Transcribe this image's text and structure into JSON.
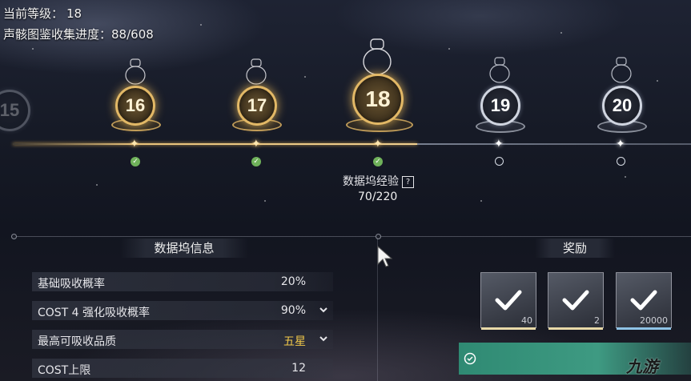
{
  "hud": {
    "level_label": "当前等级：",
    "level_value": "18",
    "collection_label": "声骸图鉴收集进度：",
    "collection_value": "88/608"
  },
  "partial_level": "15",
  "levels": [
    {
      "value": "16",
      "state": "reached",
      "claimed": true
    },
    {
      "value": "17",
      "state": "reached",
      "claimed": true
    },
    {
      "value": "18",
      "state": "current",
      "claimed": true
    },
    {
      "value": "19",
      "state": "locked",
      "claimed": false
    },
    {
      "value": "20",
      "state": "locked",
      "claimed": false
    }
  ],
  "xp": {
    "label": "数据坞经验",
    "help_icon": "question-icon",
    "value": "70/220"
  },
  "info_panel": {
    "title": "数据坞信息",
    "rows": [
      {
        "label": "基础吸收概率",
        "value": "20%",
        "expandable": false
      },
      {
        "label": "COST 4 强化吸收概率",
        "value": "90%",
        "expandable": true
      },
      {
        "label": "最高可吸收品质",
        "value": "五星",
        "expandable": true
      },
      {
        "label": "COST上限",
        "value": "12",
        "expandable": false
      }
    ]
  },
  "rewards": {
    "title": "奖励",
    "items": [
      {
        "count": "40",
        "claimed": true,
        "rarity_color": "#e8d9a8"
      },
      {
        "count": "2",
        "claimed": true,
        "rarity_color": "#e8d9a8"
      },
      {
        "count": "20000",
        "claimed": true,
        "rarity_color": "#8fc3e6"
      }
    ]
  },
  "watermark": "九游",
  "colors": {
    "gold": "#e2b866",
    "claim_green": "#3e9a82",
    "quality_gold": "#f1c84a"
  }
}
